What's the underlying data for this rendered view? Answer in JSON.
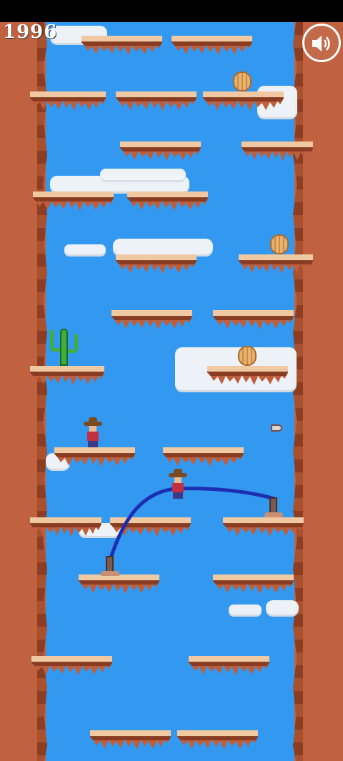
{
  "hud": {
    "score": "1996",
    "sound_icon": "speaker-on-icon"
  },
  "colors": {
    "sky": "#3399f0",
    "wall": "#c0613f",
    "platform_top": "#f0c9a2",
    "rope": "#1c2fb3"
  },
  "scene": {
    "platforms": 24,
    "barrels": 3,
    "cowboys": 2,
    "cactus": 1,
    "bullet": 1
  }
}
